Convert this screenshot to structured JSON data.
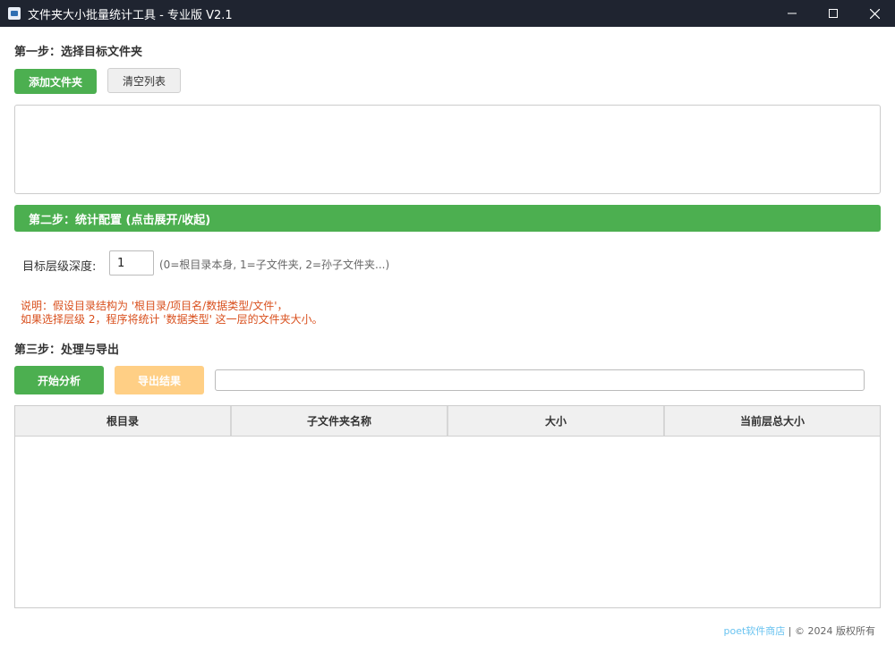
{
  "window": {
    "title": "文件夹大小批量统计工具 - 专业版 V2.1"
  },
  "step1": {
    "title": "第一步：选择目标文件夹",
    "add_button": "添加文件夹",
    "clear_button": "清空列表"
  },
  "step2": {
    "title": "第二步：统计配置 (点击展开/收起)",
    "depth_label": "目标层级深度:",
    "depth_value": "1",
    "depth_hint": "(0=根目录本身, 1=子文件夹, 2=孙子文件夹...)",
    "note_line1": "说明：假设目录结构为 '根目录/项目名/数据类型/文件'，",
    "note_line2": "如果选择层级 2，程序将统计 '数据类型' 这一层的文件夹大小。"
  },
  "step3": {
    "title": "第三步：处理与导出",
    "start_button": "开始分析",
    "export_button": "导出结果",
    "path_value": ""
  },
  "table": {
    "columns": [
      "根目录",
      "子文件夹名称",
      "大小",
      "当前层总大小"
    ],
    "rows": []
  },
  "footer": {
    "link_text": "poet软件商店",
    "separator": "|",
    "copyright": "© 2024 版权所有"
  },
  "colors": {
    "accent_green": "#4caf50",
    "export_orange": "#ffcf85",
    "note_red": "#d9501e",
    "link_blue": "#69c3f0",
    "titlebar": "#1f2430"
  }
}
